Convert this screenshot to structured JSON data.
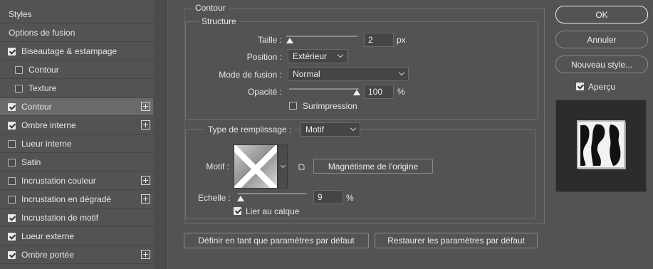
{
  "styles_list": {
    "header_styles": "Styles",
    "header_blending": "Options de fusion",
    "items": [
      {
        "label": "Biseautage & estampage",
        "checked": true,
        "sub": false,
        "plus": false,
        "selected": false
      },
      {
        "label": "Contour",
        "checked": false,
        "sub": true,
        "plus": false,
        "selected": false
      },
      {
        "label": "Texture",
        "checked": false,
        "sub": true,
        "plus": false,
        "selected": false
      },
      {
        "label": "Contour",
        "checked": true,
        "sub": false,
        "plus": true,
        "selected": true
      },
      {
        "label": "Ombre interne",
        "checked": true,
        "sub": false,
        "plus": true,
        "selected": false
      },
      {
        "label": "Lueur interne",
        "checked": false,
        "sub": false,
        "plus": false,
        "selected": false
      },
      {
        "label": "Satin",
        "checked": false,
        "sub": false,
        "plus": false,
        "selected": false
      },
      {
        "label": "Incrustation couleur",
        "checked": false,
        "sub": false,
        "plus": true,
        "selected": false
      },
      {
        "label": "Incrustation en dégradé",
        "checked": false,
        "sub": false,
        "plus": true,
        "selected": false
      },
      {
        "label": "Incrustation de motif",
        "checked": true,
        "sub": false,
        "plus": false,
        "selected": false
      },
      {
        "label": "Lueur externe",
        "checked": true,
        "sub": false,
        "plus": false,
        "selected": false
      },
      {
        "label": "Ombre portée",
        "checked": true,
        "sub": false,
        "plus": true,
        "selected": false
      }
    ]
  },
  "contour": {
    "title": "Contour",
    "structure_title": "Structure",
    "size_label": "Taille :",
    "size_value": "2",
    "size_unit": "px",
    "position_label": "Position :",
    "position_value": "Extérieur",
    "blend_label": "Mode de fusion :",
    "blend_value": "Normal",
    "opacity_label": "Opacité :",
    "opacity_value": "100",
    "opacity_unit": "%",
    "overprint_label": "Surimpression",
    "overprint_checked": false,
    "fill_type_label": "Type de remplissage :",
    "fill_type_value": "Motif",
    "pattern_label": "Motif :",
    "snap_origin_label": "Magnétisme de l'origine",
    "scale_label": "Echelle :",
    "scale_value": "9",
    "scale_unit": "%",
    "link_layer_label": "Lier au calque",
    "link_layer_checked": true,
    "set_default_label": "Définir en tant que paramètres par défaut",
    "reset_default_label": "Restaurer les paramètres par défaut"
  },
  "actions": {
    "ok_label": "OK",
    "cancel_label": "Annuler",
    "new_style_label": "Nouveau style...",
    "preview_label": "Aperçu",
    "preview_checked": true
  },
  "colors": {
    "panel_bg": "#535353",
    "selected_row": "#6a6a6a",
    "text": "#e6e6e6"
  }
}
